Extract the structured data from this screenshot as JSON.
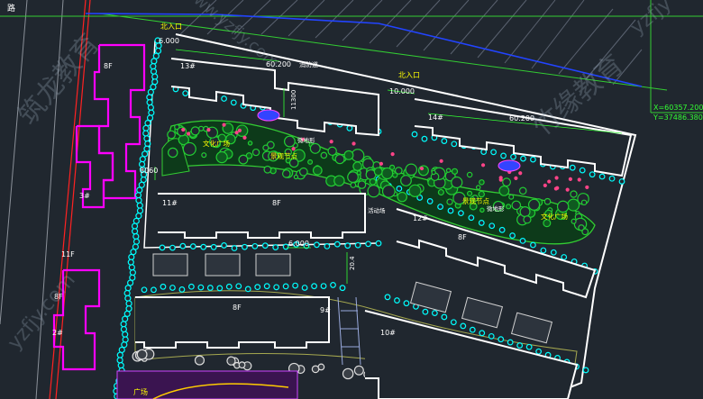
{
  "labels": {
    "entrance_top": "北入口",
    "entrance_mid": "北入口",
    "road_left": "路",
    "fire_lane": "消防道",
    "landscape_a": "景观节点",
    "landscape_b": "景观节点",
    "lawn_a": "文化广场",
    "lawn_b": "文化广场",
    "mound_a": "微地形",
    "mound_b": "微地形",
    "plaza": "广场",
    "play_area": "活动场"
  },
  "dimensions": {
    "d_6000_top": "6.000",
    "d_60200_a": "60.200",
    "d_10000": "10.000",
    "d_11300": "11300",
    "d_60200_b": "60.200",
    "d_8060": "8060",
    "d_6000_mid": "6.000",
    "d_20400": "20.4"
  },
  "buildings": {
    "b13": "13#",
    "b14": "14#",
    "b11": "11#",
    "b11_floors": "8F",
    "b12": "12#",
    "b12_floors": "8F",
    "b9": "9#",
    "b9_floors": "8F",
    "b10": "10#",
    "left_8f_top": "8F",
    "left_3": "3#",
    "left_11f": "11F",
    "left_8f_bot": "8F",
    "left_2": "2#"
  },
  "coords": {
    "x": "X=60357.200",
    "y": "Y=37486.380"
  },
  "watermarks": {
    "w1": "筑龙教育",
    "w2": "http://www.yzfjy.com",
    "w3": "yzfjy",
    "w4": "竹缘教育",
    "w5": "yzfjy.com"
  },
  "colors": {
    "background": "#20272f",
    "building_outline": "#ffffff",
    "magenta_building": "#ff00ff",
    "tree_cyan": "#00ffff",
    "tree_green": "#22cc33",
    "boundary_blue": "#2244ff",
    "red_line": "#ff2222",
    "label_yellow": "#ffff00",
    "dimension_green": "#33ff33"
  }
}
